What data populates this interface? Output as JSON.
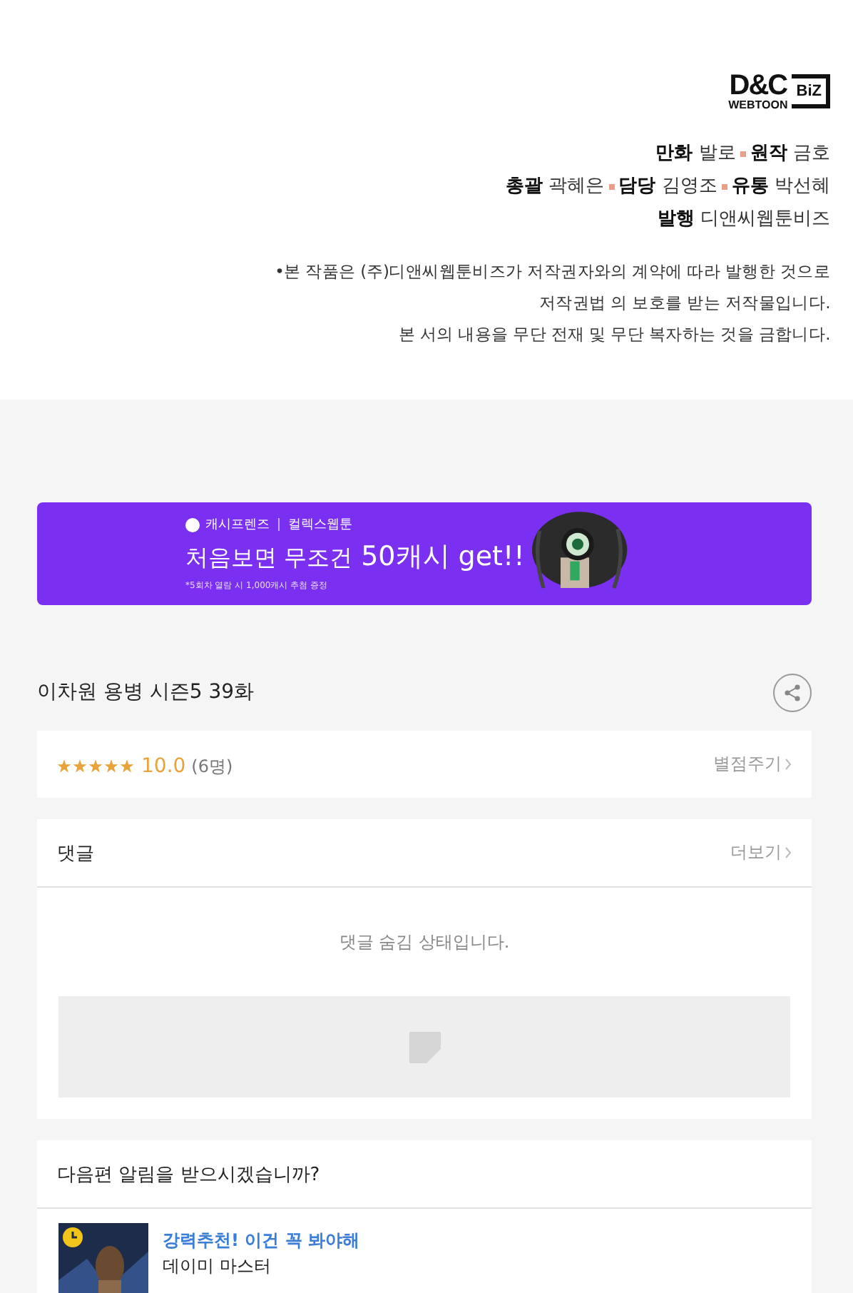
{
  "publisher_logo": {
    "main": "D&C",
    "sub": "WEBTOON",
    "badge": "BiZ"
  },
  "credits": [
    [
      {
        "role": "만화",
        "name": "발로"
      },
      {
        "role": "원작",
        "name": "금호"
      }
    ],
    [
      {
        "role": "총괄",
        "name": "곽혜은"
      },
      {
        "role": "담당",
        "name": "김영조"
      },
      {
        "role": "유통",
        "name": "박선혜"
      }
    ],
    [
      {
        "role": "발행",
        "name": "디앤씨웹툰비즈"
      }
    ]
  ],
  "notice": [
    "•본 작품은 (주)디앤씨웹툰비즈가 저작권자와의 계약에 따라 발행한 것으로",
    "저작권법 의 보호를 받는 저작물입니다.",
    "본 서의 내용을 무단 전재 및 무단 복자하는 것을 금합니다."
  ],
  "banner": {
    "brand": "캐시프렌즈",
    "partner": "컬렉스웹툰",
    "headline": "처음보면 무조건",
    "highlight": "50캐시 get!!",
    "fineprint": "*5회차 열람 시 1,000캐시 추첨 증정"
  },
  "episode_title": "이차원 용병 시즌5 39화",
  "rating": {
    "stars": 5,
    "score": "10.0",
    "count": "(6명)",
    "action": "별점주기"
  },
  "comments": {
    "title": "댓글",
    "more": "더보기",
    "message": "댓글 숨김 상태입니다."
  },
  "next_alert": {
    "question": "다음편 알림을 받으시겠습니까?",
    "items": [
      {
        "tag": "강력추천! 이건 꼭 봐야해",
        "title": "데이미 마스터"
      }
    ]
  }
}
